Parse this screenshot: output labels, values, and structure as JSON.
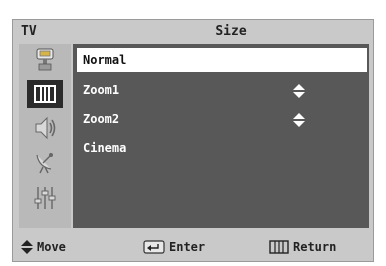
{
  "header": {
    "tv_label": "TV",
    "title": "Size"
  },
  "sidebar": {
    "icons": [
      {
        "name": "input-source-icon",
        "active": false
      },
      {
        "name": "picture-icon",
        "active": true
      },
      {
        "name": "sound-icon",
        "active": false
      },
      {
        "name": "channel-icon",
        "active": false
      },
      {
        "name": "setup-icon",
        "active": false
      }
    ]
  },
  "menu": {
    "items": [
      {
        "label": "Normal",
        "selected": true,
        "has_arrows": false
      },
      {
        "label": "Zoom1",
        "selected": false,
        "has_arrows": true
      },
      {
        "label": "Zoom2",
        "selected": false,
        "has_arrows": true
      },
      {
        "label": "Cinema",
        "selected": false,
        "has_arrows": false
      }
    ]
  },
  "footer": {
    "move_label": "Move",
    "enter_label": "Enter",
    "return_label": "Return"
  },
  "colors": {
    "panel": "#c9c9c9",
    "content": "#585858",
    "highlight": "#ffffff",
    "active_icon_bg": "#2b2b2b"
  }
}
